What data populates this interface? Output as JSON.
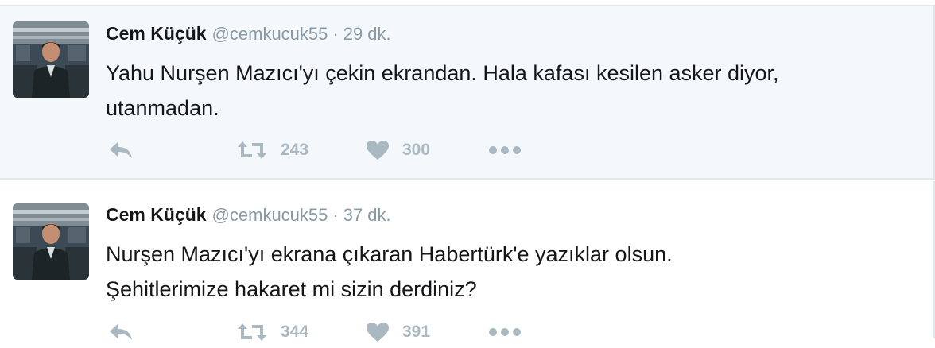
{
  "tweets": [
    {
      "fullname": "Cem Küçük",
      "username": "@cemkucuk55",
      "separator": "·",
      "time": "29 dk.",
      "text_lines": [
        "Yahu Nurşen Mazıcı'yı çekin ekrandan. Hala kafası kesilen asker diyor,",
        "utanmadan."
      ],
      "retweets": "243",
      "likes": "300"
    },
    {
      "fullname": "Cem Küçük",
      "username": "@cemkucuk55",
      "separator": "·",
      "time": "37 dk.",
      "text_lines": [
        "Nurşen Mazıcı'yı ekrana çıkaran Habertürk'e yazıklar olsun.",
        "Şehitlerimize hakaret mi sizin derdiniz?"
      ],
      "retweets": "344",
      "likes": "391"
    }
  ],
  "icons": {
    "reply": "reply-icon",
    "retweet": "retweet-icon",
    "like": "heart-icon",
    "more": "more-icon"
  },
  "colors": {
    "text": "#14171a",
    "secondary": "#8899a6",
    "action": "#aab8c2",
    "highlight_bg": "#f5f8fa",
    "border": "#e1e8ed"
  }
}
